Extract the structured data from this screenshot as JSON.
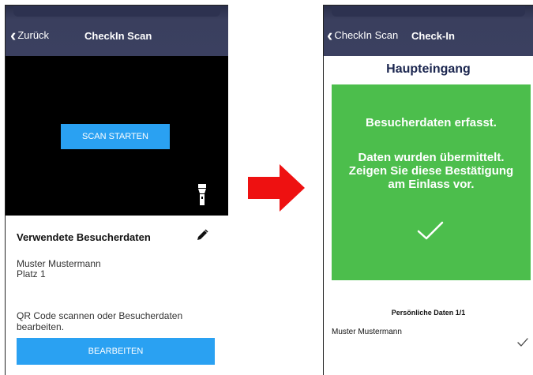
{
  "left_screen": {
    "back_label": "Zurück",
    "title": "CheckIn Scan",
    "scan_button": "SCAN STARTEN",
    "section_title": "Verwendete Besucherdaten",
    "visitor": {
      "name": "Muster Mustermann",
      "seat": "Platz 1"
    },
    "hint": "QR Code scannen oder Besucherdaten bearbeiten.",
    "edit_button": "BEARBEITEN"
  },
  "right_screen": {
    "back_label": "CheckIn Scan",
    "title": "Check-In",
    "entrance": "Haupteingang",
    "status_line": "Besucherdaten erfasst.",
    "message_lines": [
      "Daten wurden übermittelt.",
      "Zeigen Sie diese Bestätigung",
      "am Einlass vor."
    ],
    "personal_title": "Persönliche Daten 1/1",
    "personal_name": "Muster Mustermann"
  },
  "colors": {
    "navbar": "#3b4060",
    "accent_blue": "#2aa1f2",
    "success_green": "#4cbe4c",
    "arrow_red": "#ee1111"
  },
  "icons": [
    "chevron-left-icon",
    "flashlight-icon",
    "pencil-icon",
    "checkmark-icon",
    "right-arrow-icon"
  ]
}
